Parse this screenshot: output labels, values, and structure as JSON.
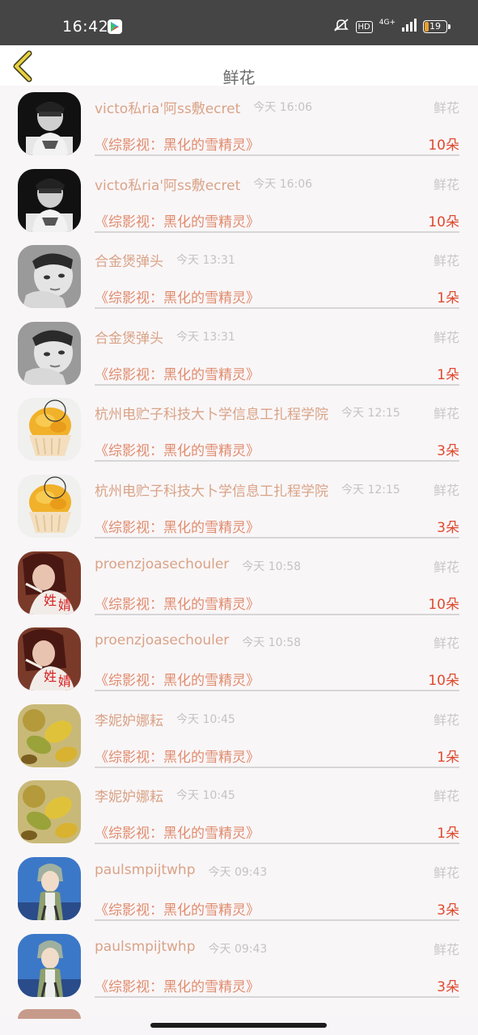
{
  "status_bar": {
    "time": "16:42",
    "hd_label": "HD",
    "network_label": "4G+",
    "battery_level": "19",
    "icons": [
      "play-store-icon",
      "mute-icon",
      "hd-icon",
      "signal-icon",
      "battery-icon"
    ]
  },
  "header": {
    "title": "鲜花",
    "back_icon": "chevron-left-icon",
    "accent_color": "#e8d040"
  },
  "colors": {
    "name": "#d9a386",
    "book": "#e08c6d",
    "count": "#df4a2e",
    "time": "#c3c3c3",
    "tag": "#c8c8c8"
  },
  "gifts": [
    {
      "name": "victo私ria'阿ss敷ecret",
      "time": "今天 16:06",
      "tag": "鲜花",
      "book": "《综影视：黑化的雪精灵》",
      "count": "10朵",
      "avatar": "dark-figure"
    },
    {
      "name": "victo私ria'阿ss敷ecret",
      "time": "今天 16:06",
      "tag": "鲜花",
      "book": "《综影视：黑化的雪精灵》",
      "count": "10朵",
      "avatar": "dark-figure"
    },
    {
      "name": "合金煲弹头",
      "time": "今天 13:31",
      "tag": "鲜花",
      "book": "《综影视：黑化的雪精灵》",
      "count": "1朵",
      "avatar": "gray-portrait"
    },
    {
      "name": "合金煲弹头",
      "time": "今天 13:31",
      "tag": "鲜花",
      "book": "《综影视：黑化的雪精灵》",
      "count": "1朵",
      "avatar": "gray-portrait"
    },
    {
      "name": "杭州电贮子科技大卜学信息工扎程学院",
      "time": "今天 12:15",
      "tag": "鲜花",
      "book": "《综影视：黑化的雪精灵》",
      "count": "3朵",
      "avatar": "cupcake"
    },
    {
      "name": "杭州电贮子科技大卜学信息工扎程学院",
      "time": "今天 12:15",
      "tag": "鲜花",
      "book": "《综影视：黑化的雪精灵》",
      "count": "3朵",
      "avatar": "cupcake"
    },
    {
      "name": "proenzjoasechouler",
      "time": "今天 10:58",
      "tag": "鲜花",
      "book": "《综影视：黑化的雪精灵》",
      "count": "10朵",
      "avatar": "red-girl"
    },
    {
      "name": "proenzjoasechouler",
      "time": "今天 10:58",
      "tag": "鲜花",
      "book": "《综影视：黑化的雪精灵》",
      "count": "10朵",
      "avatar": "red-girl"
    },
    {
      "name": "李妮妒娜耘",
      "time": "今天 10:45",
      "tag": "鲜花",
      "book": "《综影视：黑化的雪精灵》",
      "count": "1朵",
      "avatar": "leaves"
    },
    {
      "name": "李妮妒娜耘",
      "time": "今天 10:45",
      "tag": "鲜花",
      "book": "《综影视：黑化的雪精灵》",
      "count": "1朵",
      "avatar": "leaves"
    },
    {
      "name": "paulsmpijtwhp",
      "time": "今天 09:43",
      "tag": "鲜花",
      "book": "《综影视：黑化的雪精灵》",
      "count": "3朵",
      "avatar": "anime-boy"
    },
    {
      "name": "paulsmpijtwhp",
      "time": "今天 09:43",
      "tag": "鲜花",
      "book": "《综影视：黑化的雪精灵》",
      "count": "3朵",
      "avatar": "anime-boy"
    }
  ]
}
